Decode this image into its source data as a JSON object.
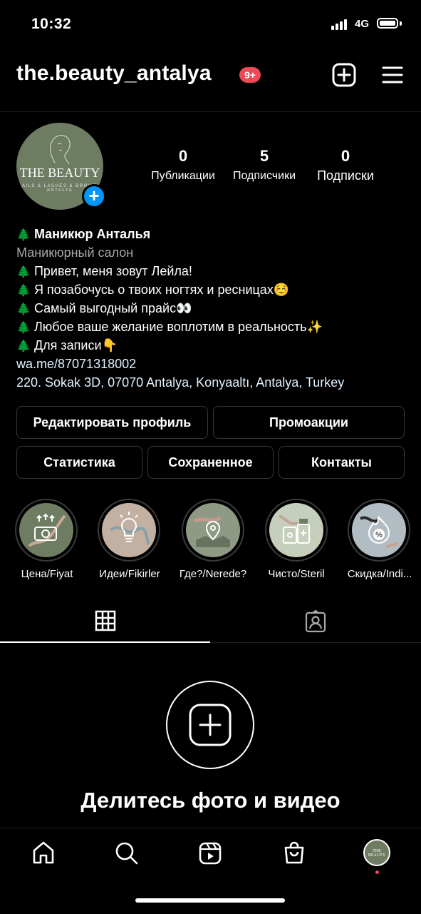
{
  "status_bar": {
    "time": "10:32",
    "network": "4G"
  },
  "header": {
    "username": "the.beauty_antalya",
    "notifications": "9+"
  },
  "profile": {
    "avatar": {
      "name": "THE BEAUTY",
      "sub": "NAILS & LASHES & BROWS · ANTALYA"
    },
    "stats": [
      {
        "value": "0",
        "label": "Публикации"
      },
      {
        "value": "5",
        "label": "Подписчики"
      },
      {
        "value": "0",
        "label": "Подписки"
      }
    ]
  },
  "bio": {
    "name": "Маникюр Анталья",
    "category": "Маникюрный салон",
    "lines": [
      "Привет, меня зовут Лейла!",
      "Я позабочусь о твоих ногтях и ресницах☺️",
      "Самый выгодный прайс👀",
      "Любое ваше желание воплотим в реальность✨",
      "Для записи👇"
    ],
    "link": "wa.me/87071318002",
    "address": "220. Sokak 3D, 07070 Antalya, Konyaaltı, Antalya, Turkey"
  },
  "buttons": {
    "edit_profile": "Редактировать профиль",
    "promotions": "Промоакции",
    "statistics": "Статистика",
    "saved": "Сохраненное",
    "contacts": "Контакты"
  },
  "highlights": [
    {
      "label": "Цена/Fiyat",
      "icon": "price-icon",
      "bg": "#6e7c62"
    },
    {
      "label": "Идеи/Fikirler",
      "icon": "lightbulb-icon",
      "bg": "#c2b0a3"
    },
    {
      "label": "Где?/Nerede?",
      "icon": "map-pin-icon",
      "bg": "#8e9a83"
    },
    {
      "label": "Чисто/Steril",
      "icon": "sterile-icon",
      "bg": "#c6cfbb"
    },
    {
      "label": "Скидка/Indi...",
      "icon": "discount-icon",
      "bg": "#b2bcc3"
    }
  ],
  "tabs": [
    {
      "icon": "grid-icon"
    },
    {
      "icon": "tagged-icon"
    }
  ],
  "empty_state": {
    "title": "Делитесь фото и видео"
  },
  "bottom_nav": {
    "items": [
      "home-icon",
      "search-icon",
      "reels-icon",
      "shop-icon",
      "profile-avatar"
    ],
    "avatar_text": "THE BEAUTY"
  },
  "colors": {
    "accent_blue": "#0095f6",
    "notification_red": "#ed4956",
    "avatar_green": "#6e7c62"
  }
}
